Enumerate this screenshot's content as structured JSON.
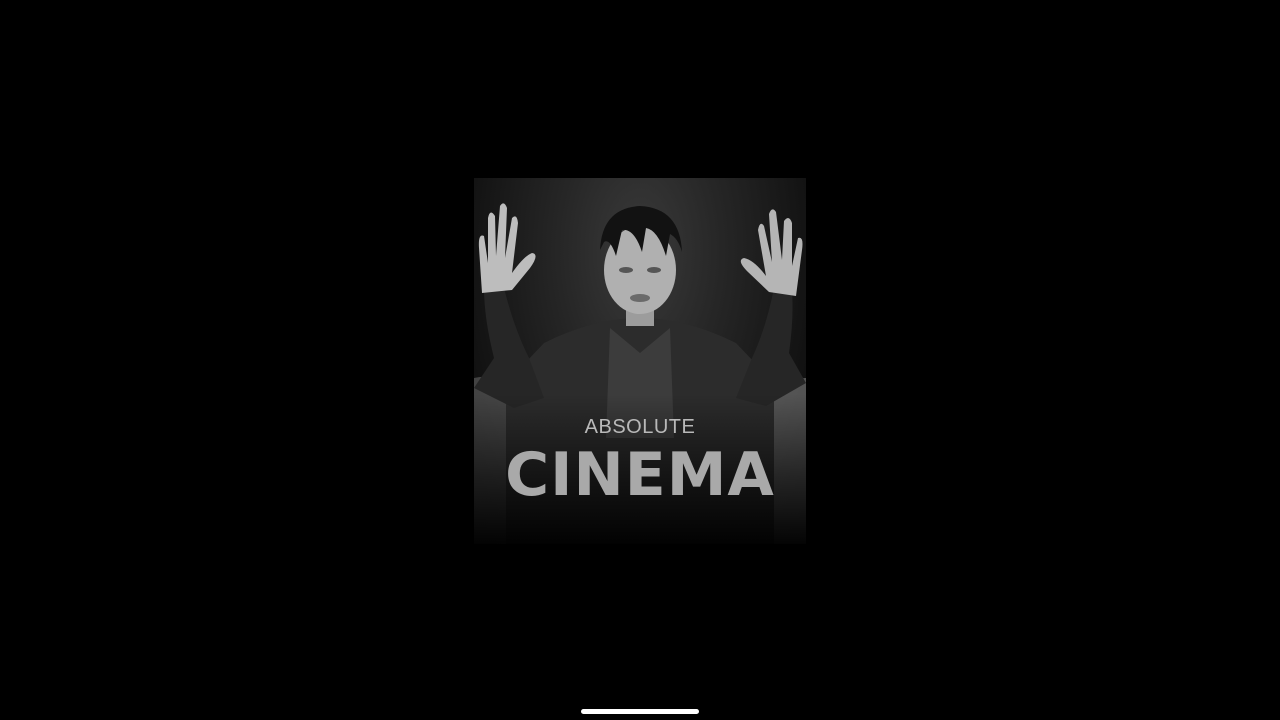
{
  "meme": {
    "line1": "ABSOLUTE",
    "line2": "CINEMA"
  },
  "photo": {
    "subject": "person-raised-hands-in-armchair",
    "style": "black-and-white"
  },
  "colors": {
    "background": "#000000",
    "caption_small": "#b9b9b9",
    "caption_large": "#a9a9a9",
    "home_indicator": "#ffffff"
  }
}
